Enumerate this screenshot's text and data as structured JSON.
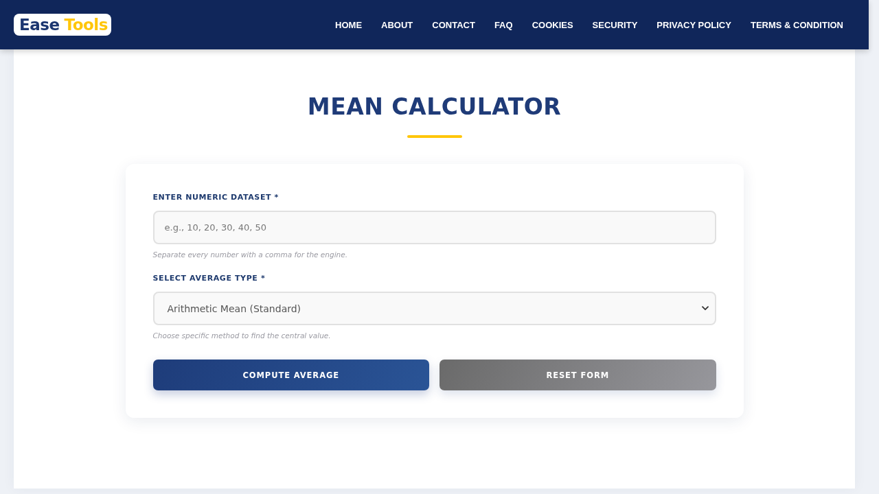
{
  "header": {
    "logo": {
      "part_1": "Ease",
      "part_2": "Tools"
    },
    "nav": [
      "HOME",
      "ABOUT",
      "CONTACT",
      "FAQ",
      "COOKIES",
      "SECURITY",
      "PRIVACY POLICY",
      "TERMS & CONDITION"
    ]
  },
  "page": {
    "title": "MEAN CALCULATOR"
  },
  "form": {
    "fields": [
      {
        "kind": "text",
        "label": "ENTER NUMERIC DATASET *",
        "placeholder": "e.g., 10, 20, 30, 40, 50",
        "hint": "Separate every number with a comma for the engine."
      },
      {
        "kind": "select",
        "label": "SELECT AVERAGE TYPE *",
        "value": "Arithmetic Mean (Standard)",
        "hint": "Choose specific method to find the central value."
      }
    ],
    "buttons": [
      {
        "kind": "primary",
        "label": "COMPUTE AVERAGE"
      },
      {
        "kind": "secondary",
        "label": "RESET FORM"
      }
    ]
  }
}
